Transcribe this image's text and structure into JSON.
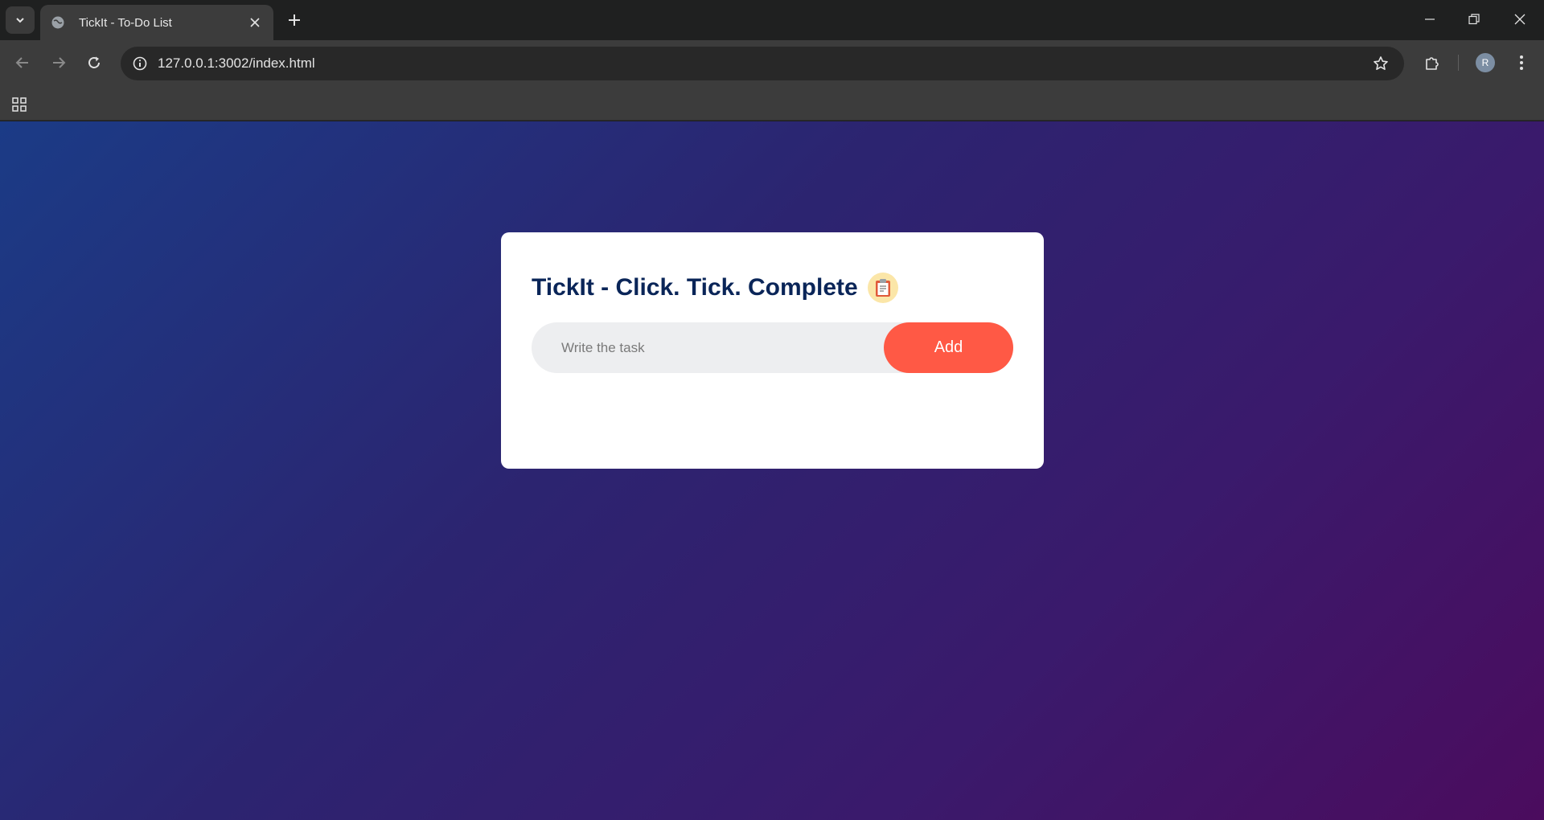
{
  "browser": {
    "tab": {
      "title": "TickIt - To-Do List"
    },
    "address": {
      "url": "127.0.0.1:3002/index.html"
    },
    "profile": {
      "initial": "R"
    }
  },
  "page": {
    "title": "TickIt - Click. Tick. Complete",
    "title_emoji": "📋",
    "input": {
      "placeholder": "Write the task",
      "value": ""
    },
    "add_button": "Add",
    "tasks": []
  },
  "colors": {
    "accent_button": "#ff5945",
    "title_text": "#0a2558",
    "gradient_start": "#1b3b86",
    "gradient_end": "#4b0c5e"
  }
}
